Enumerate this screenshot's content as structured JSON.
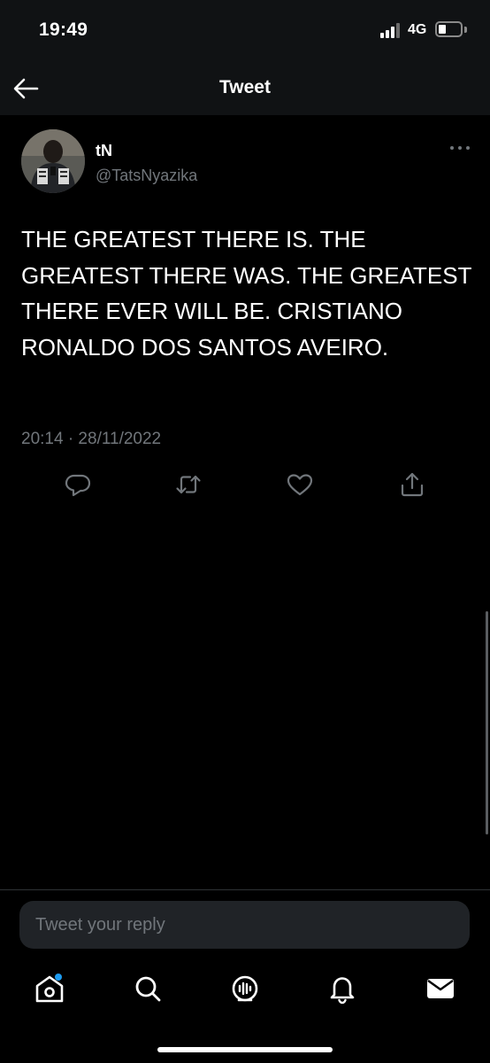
{
  "status_bar": {
    "time": "19:49",
    "network": "4G"
  },
  "header": {
    "title": "Tweet"
  },
  "tweet": {
    "author": {
      "display_name": "tN",
      "handle": "@TatsNyazika"
    },
    "text": "THE GREATEST THERE IS. THE GREATEST THERE WAS. THE GREATEST THERE EVER WILL BE. CRISTIANO RONALDO DOS SANTOS AVEIRO.",
    "timestamp": "20:14 · 28/11/2022"
  },
  "composer": {
    "placeholder": "Tweet your reply"
  },
  "icons": {
    "back": "arrow-left-icon",
    "more": "more-dots-icon",
    "actions": [
      "reply-icon",
      "retweet-icon",
      "like-icon",
      "share-icon"
    ],
    "nav": [
      "home-icon",
      "search-icon",
      "spaces-icon",
      "notifications-icon",
      "messages-icon"
    ]
  },
  "colors": {
    "background": "#000000",
    "text": "#e7e9ea",
    "secondary_text": "#71767b",
    "accent": "#1d9bf0"
  }
}
